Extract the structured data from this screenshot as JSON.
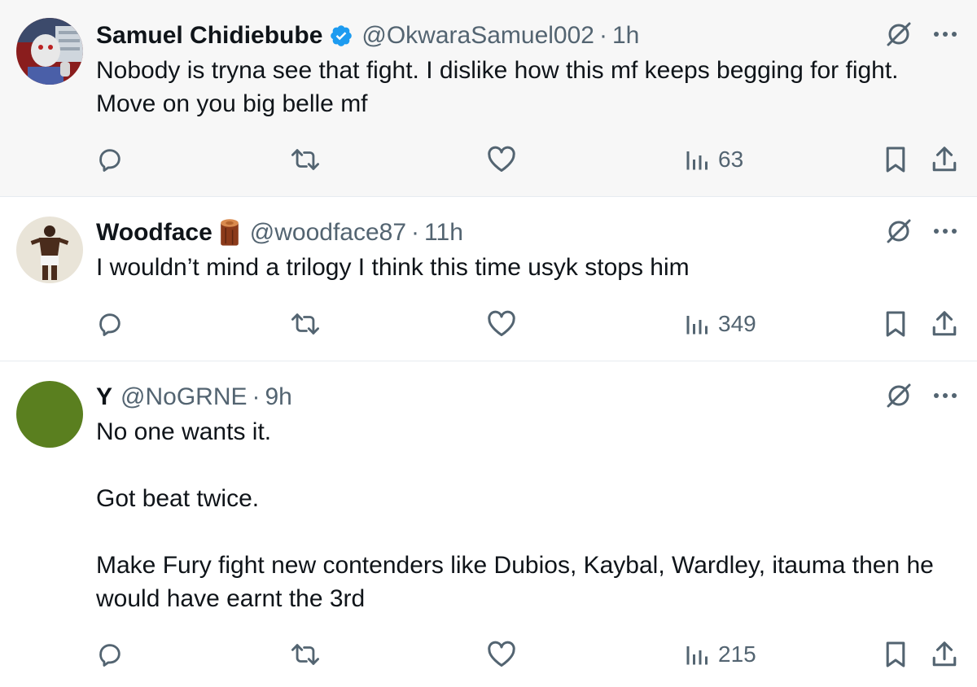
{
  "tweets": [
    {
      "name": "Samuel Chidiebube",
      "verified": true,
      "handle": "@OkwaraSamuel002",
      "separator": "·",
      "time": "1h",
      "text": "Nobody is tryna see that fight. I dislike how this mf keeps begging for fight. Move on you big belle mf",
      "views": "63",
      "avatar_color": "#8a1d1d"
    },
    {
      "name": "Woodface",
      "name_emoji": "log-emoji",
      "handle": "@woodface87",
      "separator": "·",
      "time": "11h",
      "text": "I wouldn’t mind a trilogy I think this time usyk stops him",
      "views": "349",
      "avatar_color": "#e9e4d8"
    },
    {
      "name": "Y",
      "handle": "@NoGRNE",
      "separator": "·",
      "time": "9h",
      "text": "No one wants it.\n\nGot beat twice.\n\nMake Fury fight new contenders like Dubios, Kaybal, Wardley, itauma then he would have earnt the 3rd",
      "views": "215",
      "avatar_color": "#5a7f1f"
    }
  ],
  "icons": {
    "grok": "grok-slash-icon",
    "more": "more-dots-icon",
    "reply": "reply-bubble-icon",
    "retweet": "retweet-arrows-icon",
    "like": "heart-icon",
    "views": "views-bars-icon",
    "bookmark": "bookmark-icon",
    "share": "share-upload-icon"
  },
  "colors": {
    "verified_blue": "#1d9bf0",
    "muted_text": "#536471",
    "highlight_row": "#f7f7f7"
  }
}
